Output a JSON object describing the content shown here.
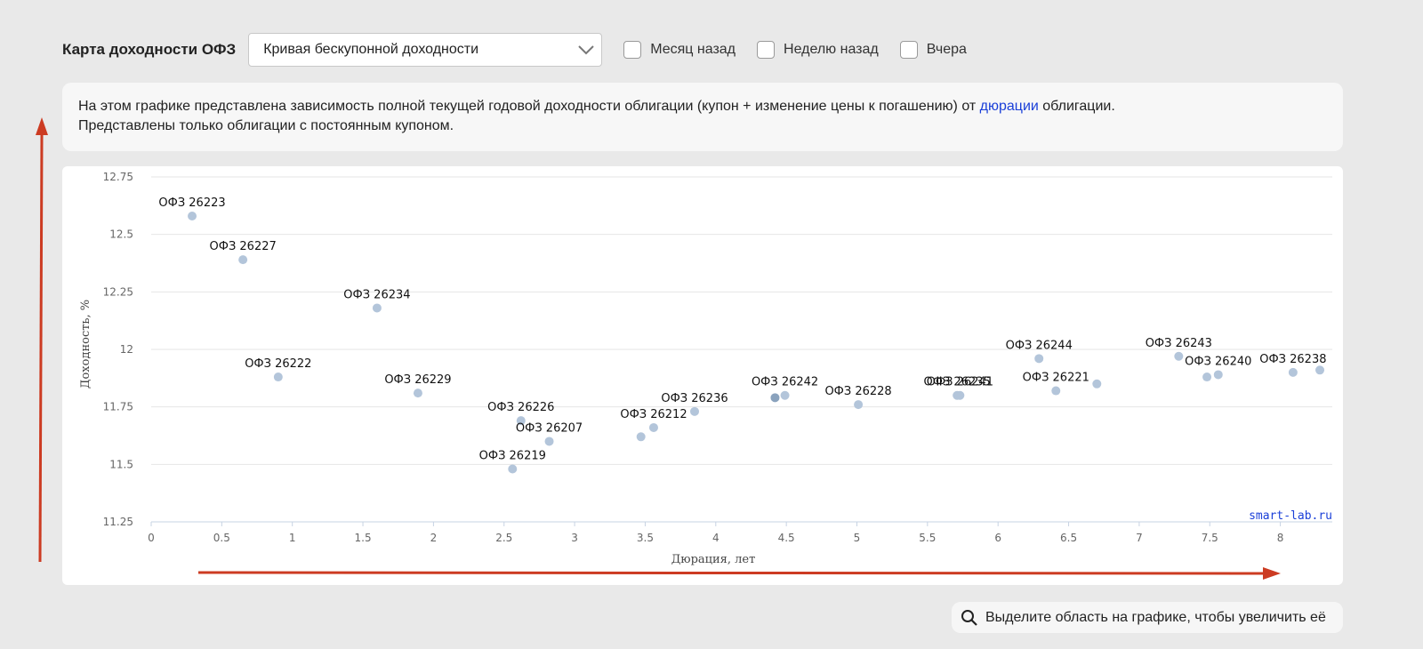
{
  "header": {
    "title": "Карта доходности ОФЗ",
    "select_value": "Кривая бескупонной доходности",
    "checkboxes": [
      {
        "label": "Месяц назад",
        "checked": false
      },
      {
        "label": "Неделю назад",
        "checked": false
      },
      {
        "label": "Вчера",
        "checked": false
      }
    ]
  },
  "info": {
    "text_before": "На этом графике представлена зависимость полной текущей годовой доходности облигации (купон + изменение цены к погашению) от ",
    "link": "дюрации",
    "text_after": " облигации.",
    "line2": "Представлены только облигации с постоянным купоном."
  },
  "hint": {
    "icon": "magnifier-icon",
    "text": "Выделите область на графике, чтобы увеличить её"
  },
  "watermark": "smart-lab.ru",
  "colors": {
    "point": "#b3c5da",
    "point_dark": "#8aa2bd",
    "annotation_arrow": "#cc3b22",
    "link": "#1a3fd8"
  },
  "chart_data": {
    "type": "scatter",
    "xlabel": "Дюрация, лет",
    "ylabel": "Доходность, %",
    "xlim": [
      0,
      8.35
    ],
    "ylim": [
      11.25,
      12.75
    ],
    "x_ticks": [
      "0",
      "0.5",
      "1",
      "1.5",
      "2",
      "2.5",
      "3",
      "3.5",
      "4",
      "4.5",
      "5",
      "5.5",
      "6",
      "6.5",
      "7",
      "7.5",
      "8"
    ],
    "y_ticks": [
      "11.25",
      "11.5",
      "11.75",
      "12",
      "12.25",
      "12.5",
      "12.75"
    ],
    "grid": true,
    "points": [
      {
        "x": 0.29,
        "y": 12.58,
        "label": "ОФЗ 26223"
      },
      {
        "x": 0.65,
        "y": 12.39,
        "label": "ОФЗ 26227"
      },
      {
        "x": 0.9,
        "y": 11.88,
        "label": "ОФЗ 26222"
      },
      {
        "x": 1.6,
        "y": 12.18,
        "label": "ОФЗ 26234"
      },
      {
        "x": 1.89,
        "y": 11.81,
        "label": "ОФЗ 26229"
      },
      {
        "x": 2.56,
        "y": 11.48,
        "label": "ОФЗ 26219"
      },
      {
        "x": 2.62,
        "y": 11.69,
        "label": "ОФЗ 26226"
      },
      {
        "x": 2.82,
        "y": 11.6,
        "label": "ОФЗ 26207"
      },
      {
        "x": 3.47,
        "y": 11.62,
        "label": ""
      },
      {
        "x": 3.56,
        "y": 11.66,
        "label": "ОФЗ 26212"
      },
      {
        "x": 3.85,
        "y": 11.73,
        "label": "ОФЗ 26236"
      },
      {
        "x": 4.42,
        "y": 11.79,
        "label": ""
      },
      {
        "x": 4.49,
        "y": 11.8,
        "label": "ОФЗ 26242"
      },
      {
        "x": 5.01,
        "y": 11.76,
        "label": "ОФЗ 26228"
      },
      {
        "x": 5.71,
        "y": 11.8,
        "label": "ОФЗ 26235"
      },
      {
        "x": 5.73,
        "y": 11.8,
        "label": "ОФЗ 26241"
      },
      {
        "x": 6.29,
        "y": 11.96,
        "label": "ОФЗ 26244"
      },
      {
        "x": 6.41,
        "y": 11.82,
        "label": "ОФЗ 26221"
      },
      {
        "x": 6.7,
        "y": 11.85,
        "label": ""
      },
      {
        "x": 7.28,
        "y": 11.97,
        "label": "ОФЗ 26243"
      },
      {
        "x": 7.48,
        "y": 11.88,
        "label": ""
      },
      {
        "x": 7.56,
        "y": 11.89,
        "label": "ОФЗ 26240"
      },
      {
        "x": 8.09,
        "y": 11.9,
        "label": "ОФЗ 26238"
      },
      {
        "x": 8.28,
        "y": 11.91,
        "label": ""
      }
    ]
  }
}
